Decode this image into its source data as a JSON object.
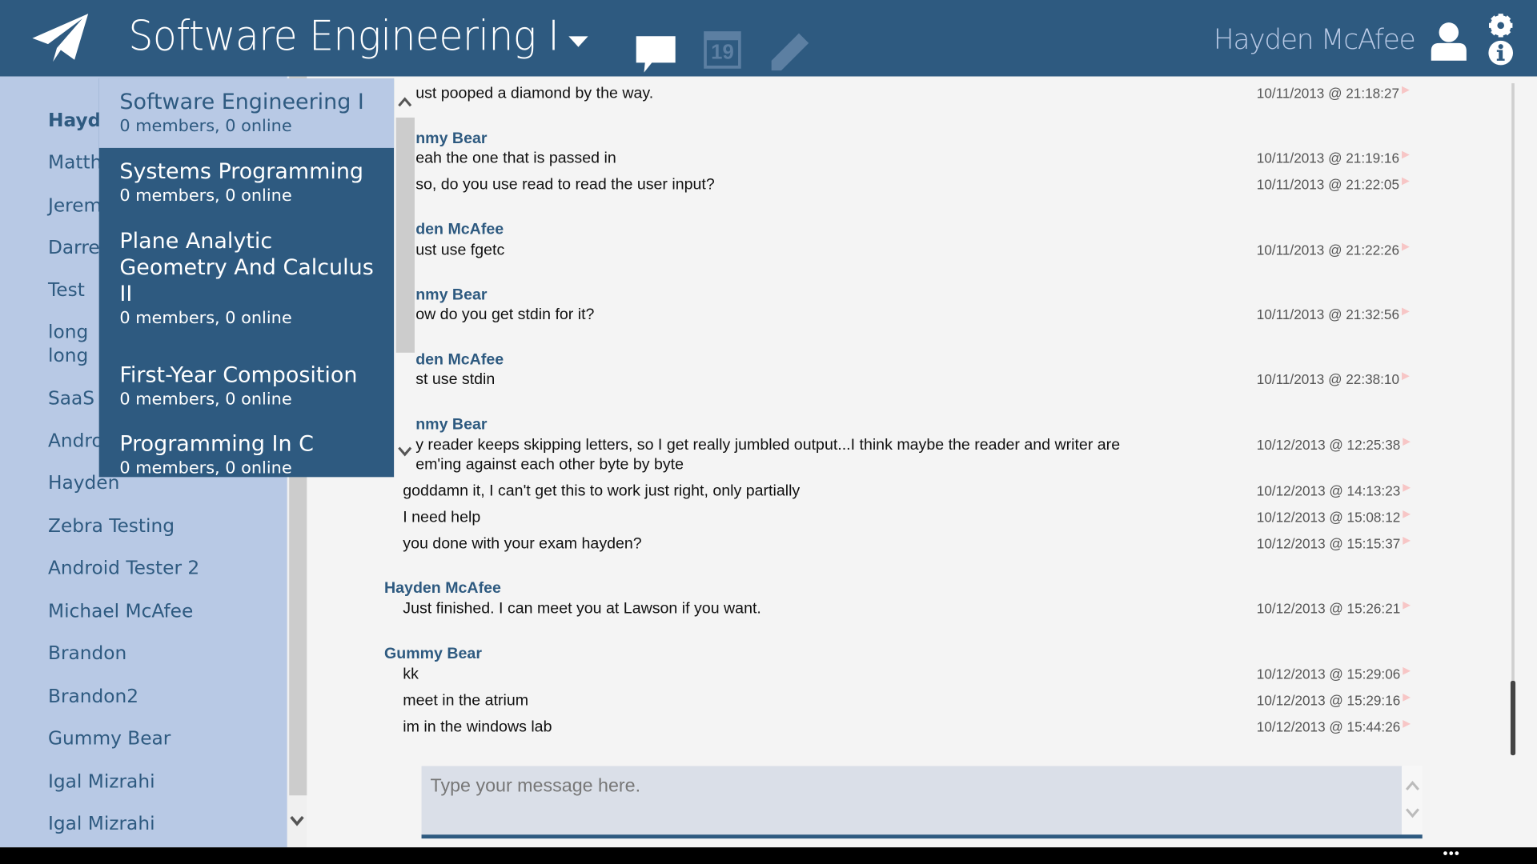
{
  "header": {
    "title": "Software Engineering I",
    "user_name": "Hayden McAfee",
    "calendar_day": "19",
    "icons": [
      "paper-plane-icon",
      "chevron-down-icon",
      "chat-bubble-icon",
      "calendar-icon",
      "pencil-icon",
      "user-icon",
      "gear-icon",
      "info-icon"
    ],
    "color": "#2e5a80"
  },
  "sidebar": {
    "items": [
      {
        "label": "Hayd",
        "bold": true
      },
      {
        "label": "Matth"
      },
      {
        "label": "Jerem"
      },
      {
        "label": "Darre"
      },
      {
        "label": "Test"
      },
      {
        "label": "long\nlong"
      },
      {
        "label": "SaaS"
      },
      {
        "label": "Andro"
      },
      {
        "label": "Hayden"
      },
      {
        "label": "Zebra Testing"
      },
      {
        "label": "Android Tester 2"
      },
      {
        "label": "Michael McAfee"
      },
      {
        "label": "Brandon"
      },
      {
        "label": "Brandon2"
      },
      {
        "label": "Gummy Bear"
      },
      {
        "label": "Igal Mizrahi"
      },
      {
        "label": "Igal Mizrahi"
      }
    ],
    "color": "#b8c9e5"
  },
  "dropdown": {
    "items": [
      {
        "name": "Software Engineering I",
        "meta": "0 members, 0 online",
        "selected": true
      },
      {
        "name": "Systems Programming",
        "meta": "0 members, 0 online"
      },
      {
        "name": "Plane Analytic Geometry And Calculus II",
        "meta": "0 members, 0 online"
      },
      {
        "name": "First-Year Composition",
        "meta": "0 members, 0 online"
      },
      {
        "name": "Programming In C",
        "meta": "0 members, 0 online"
      }
    ]
  },
  "chat": {
    "entries": [
      {
        "type": "msg",
        "text": "ust pooped a diamond by the way.",
        "ts": "10/11/2013 @ 21:18:27",
        "clipped": true
      },
      {
        "type": "sender",
        "text": "nmy Bear",
        "clipped": true
      },
      {
        "type": "msg",
        "text": "eah the one that is passed in",
        "ts": "10/11/2013 @ 21:19:16",
        "clipped": true
      },
      {
        "type": "msg",
        "text": "so, do you use read to read the user input?",
        "ts": "10/11/2013 @ 21:22:05",
        "clipped": true
      },
      {
        "type": "sender",
        "text": "den McAfee",
        "clipped": true
      },
      {
        "type": "msg",
        "text": "ust use fgetc",
        "ts": "10/11/2013 @ 21:22:26",
        "clipped": true
      },
      {
        "type": "sender",
        "text": "nmy Bear",
        "clipped": true
      },
      {
        "type": "msg",
        "text": "ow do you get stdin for it?",
        "ts": "10/11/2013 @ 21:32:56",
        "clipped": true
      },
      {
        "type": "sender",
        "text": "den McAfee",
        "clipped": true
      },
      {
        "type": "msg",
        "text": "st use stdin",
        "ts": "10/11/2013 @ 22:38:10",
        "clipped": true
      },
      {
        "type": "sender",
        "text": "nmy Bear",
        "clipped": true
      },
      {
        "type": "msg",
        "text": "y reader keeps skipping letters, so I get really jumbled output...I think maybe the reader and writer are\nem'ing against each other byte by byte",
        "ts": "10/12/2013 @ 12:25:38",
        "clipped": true
      },
      {
        "type": "msg",
        "text": "goddamn it, I can't get this to work just right, only partially",
        "ts": "10/12/2013 @ 14:13:23"
      },
      {
        "type": "msg",
        "text": "I need help",
        "ts": "10/12/2013 @ 15:08:12"
      },
      {
        "type": "msg",
        "text": "you done with your exam hayden?",
        "ts": "10/12/2013 @ 15:15:37"
      },
      {
        "type": "sender",
        "text": "Hayden McAfee"
      },
      {
        "type": "msg",
        "text": "Just finished. I can meet you at Lawson if you want.",
        "ts": "10/12/2013 @ 15:26:21"
      },
      {
        "type": "sender",
        "text": "Gummy Bear"
      },
      {
        "type": "msg",
        "text": "kk",
        "ts": "10/12/2013 @ 15:29:06"
      },
      {
        "type": "msg",
        "text": "meet in the atrium",
        "ts": "10/12/2013 @ 15:29:16"
      },
      {
        "type": "msg",
        "text": "im in the windows lab",
        "ts": "10/12/2013 @ 15:44:26"
      }
    ]
  },
  "composer": {
    "placeholder": "Type your message here.",
    "value": ""
  },
  "taskbar": {
    "more_label": "•••"
  }
}
